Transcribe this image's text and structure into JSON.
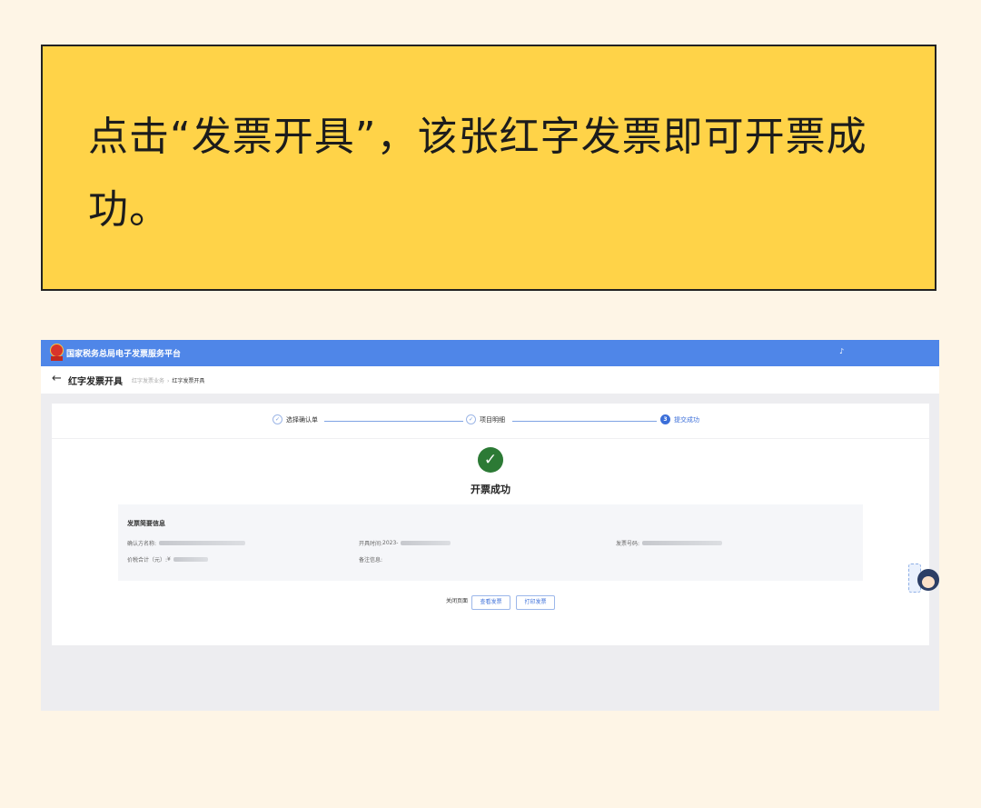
{
  "banner": {
    "text": "点击“发票开具”，该张红字发票即可开票成功。"
  },
  "app": {
    "platform_title": "国家税务总局电子发票服务平台",
    "topbar_glyph": "♪",
    "page_title": "红字发票开具",
    "breadcrumb": [
      "红字发票业务",
      "红字发票开具"
    ]
  },
  "steps": [
    {
      "label": "选择确认单",
      "status": "done",
      "icon": "✓"
    },
    {
      "label": "项目明细",
      "status": "done",
      "icon": "✓"
    },
    {
      "label": "提交成功",
      "status": "current",
      "icon": "3"
    }
  ],
  "success": {
    "icon": "✓",
    "title": "开票成功"
  },
  "summary": {
    "heading": "发票简要信息",
    "fields": {
      "confirmer_name": {
        "label": "确认方名称:",
        "value": ""
      },
      "issue_time": {
        "label": "开具时间:",
        "value": "2023-"
      },
      "invoice_no": {
        "label": "发票号码:",
        "value": ""
      },
      "total_tax": {
        "label": "价税合计（元）:",
        "value": "¥"
      },
      "remarks": {
        "label": "备注信息:",
        "value": ""
      }
    }
  },
  "buttons": {
    "close": "关闭页面",
    "view": "查看发票",
    "print": "打印发票"
  },
  "colors": {
    "banner_bg": "#ffd348",
    "topbar": "#4f86e8",
    "accent": "#3c6fd9",
    "success": "#2c7a35"
  }
}
